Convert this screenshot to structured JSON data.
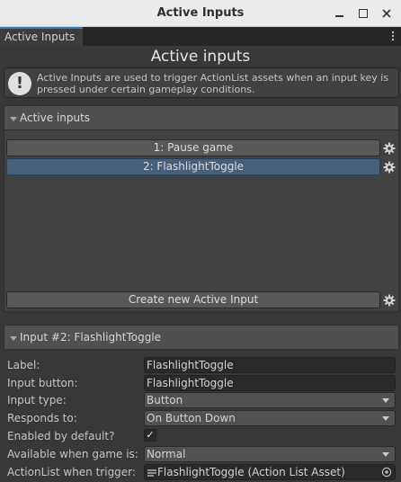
{
  "window": {
    "title": "Active Inputs"
  },
  "tab": {
    "label": "Active Inputs"
  },
  "heading": "Active inputs",
  "info": {
    "text": "Active Inputs are used to trigger ActionList assets when an input key is pressed under certain gameplay conditions."
  },
  "list_section": {
    "title": "Active inputs",
    "items": [
      {
        "label": "1: Pause game",
        "selected": false
      },
      {
        "label": "2: FlashlightToggle",
        "selected": true
      }
    ],
    "create_label": "Create new Active Input"
  },
  "detail_section": {
    "title": "Input #2: FlashlightToggle",
    "fields": {
      "label": {
        "label": "Label:",
        "value": "FlashlightToggle"
      },
      "input_button": {
        "label": "Input button:",
        "value": "FlashlightToggle"
      },
      "input_type": {
        "label": "Input type:",
        "value": "Button"
      },
      "responds_to": {
        "label": "Responds to:",
        "value": "On Button Down"
      },
      "enabled_by_default": {
        "label": "Enabled by default?",
        "checked": true,
        "mark": "✓"
      },
      "available_when": {
        "label": "Available when game is:",
        "value": "Normal"
      },
      "actionlist": {
        "label": "ActionList when trigger:",
        "value": "FlashlightToggle (Action List Asset)"
      }
    }
  },
  "colors": {
    "accent": "#3a79bb",
    "selected": "#46607c",
    "background": "#383838"
  }
}
